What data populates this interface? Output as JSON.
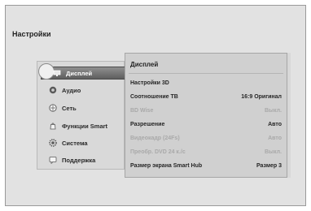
{
  "screen": {
    "title": "Настройки"
  },
  "menu": {
    "items": [
      {
        "label": "Дисплей",
        "icon": "display-icon",
        "selected": true
      },
      {
        "label": "Аудио",
        "icon": "audio-icon",
        "selected": false
      },
      {
        "label": "Сеть",
        "icon": "network-icon",
        "selected": false
      },
      {
        "label": "Функции Smart",
        "icon": "smart-icon",
        "selected": false
      },
      {
        "label": "Система",
        "icon": "system-gear-icon",
        "selected": false
      },
      {
        "label": "Поддержка",
        "icon": "support-icon",
        "selected": false
      }
    ]
  },
  "panel": {
    "title": "Дисплей",
    "rows": [
      {
        "label": "Настройки 3D",
        "value": "",
        "disabled": false
      },
      {
        "label": "Соотношение ТВ",
        "value": "16:9 Оригинал",
        "disabled": false
      },
      {
        "label": "BD Wise",
        "value": "Выкл.",
        "disabled": true
      },
      {
        "label": "Разрешение",
        "value": "Авто",
        "disabled": false
      },
      {
        "label": "Видеокадр (24Fs)",
        "value": "Авто",
        "disabled": true
      },
      {
        "label": "Преобр. DVD 24 к./с",
        "value": "Выкл.",
        "disabled": true
      },
      {
        "label": "Размер экрана Smart Hub",
        "value": "Размер 3",
        "disabled": false
      }
    ]
  },
  "colors": {
    "background": "#e2e2e2",
    "selected_item": "#6e6e6e",
    "disabled_text": "#a9a9a9"
  }
}
